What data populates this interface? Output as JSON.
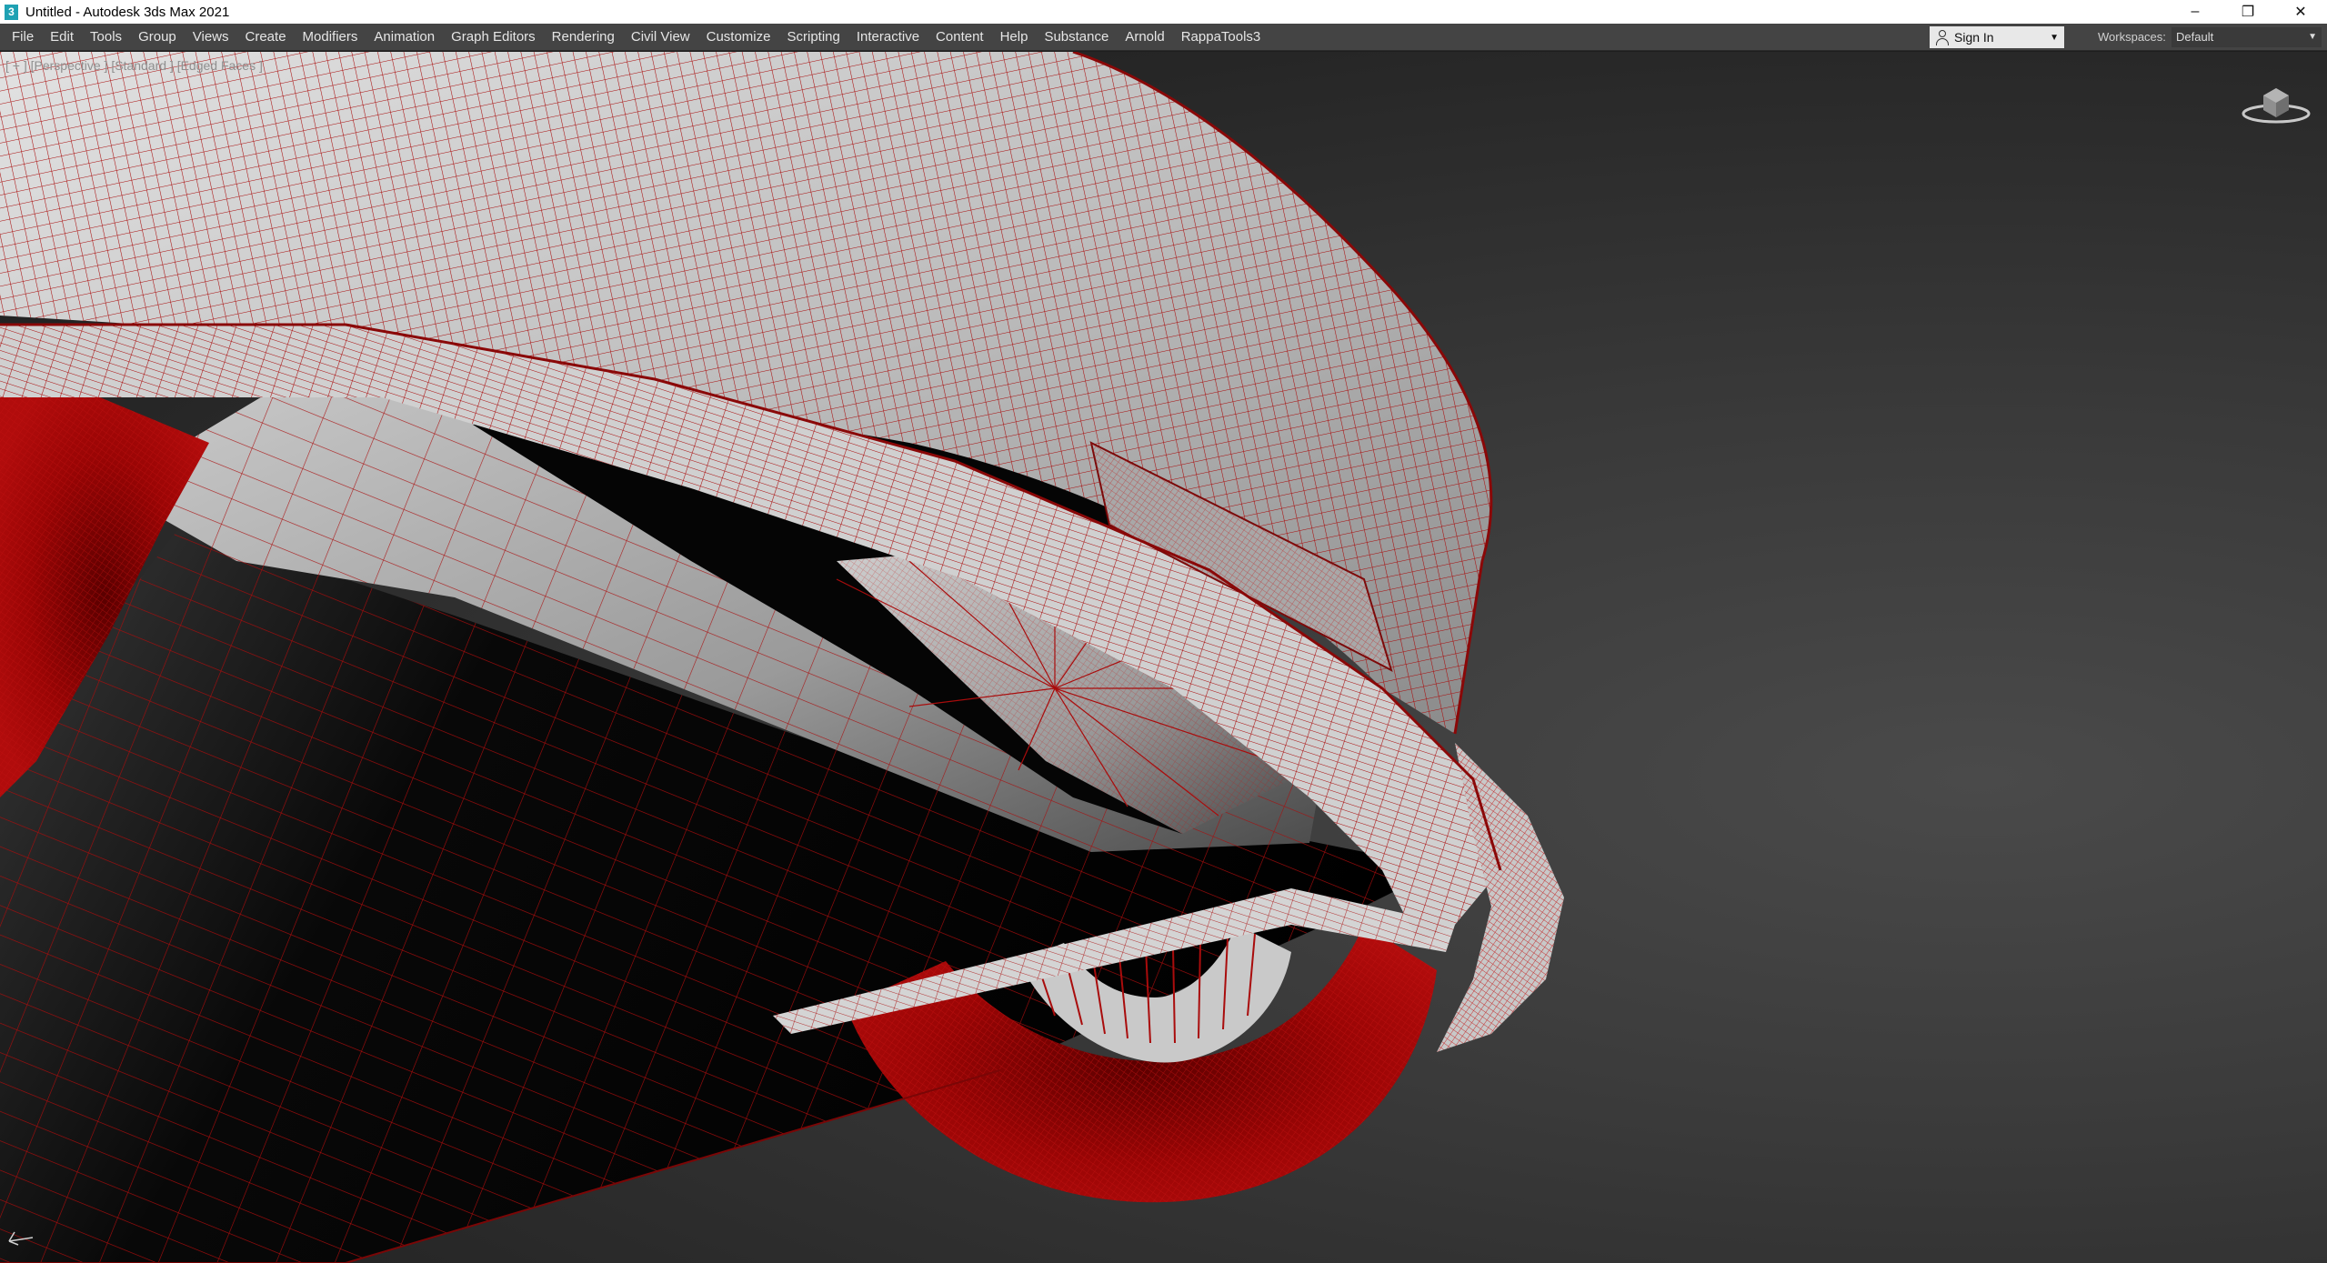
{
  "window": {
    "title": "Untitled - Autodesk 3ds Max 2021"
  },
  "window_controls": {
    "minimize": "–",
    "restore": "❐",
    "close": "✕"
  },
  "menu": {
    "items": [
      "File",
      "Edit",
      "Tools",
      "Group",
      "Views",
      "Create",
      "Modifiers",
      "Animation",
      "Graph Editors",
      "Rendering",
      "Civil View",
      "Customize",
      "Scripting",
      "Interactive",
      "Content",
      "Help",
      "Substance",
      "Arnold",
      "RappaTools3"
    ]
  },
  "account": {
    "sign_in_label": "Sign In"
  },
  "workspaces": {
    "label": "Workspaces:",
    "value": "Default"
  },
  "viewport": {
    "label": "[ + ] [Perspective ] [Standard ] [Edged Faces ]",
    "wire_color": "#b00d0d",
    "shading_color": "#bdbdbd"
  },
  "colors": {
    "menubar_bg": "#444444",
    "titlebar_bg": "#ffffff",
    "viewport_bg": "#353535"
  }
}
